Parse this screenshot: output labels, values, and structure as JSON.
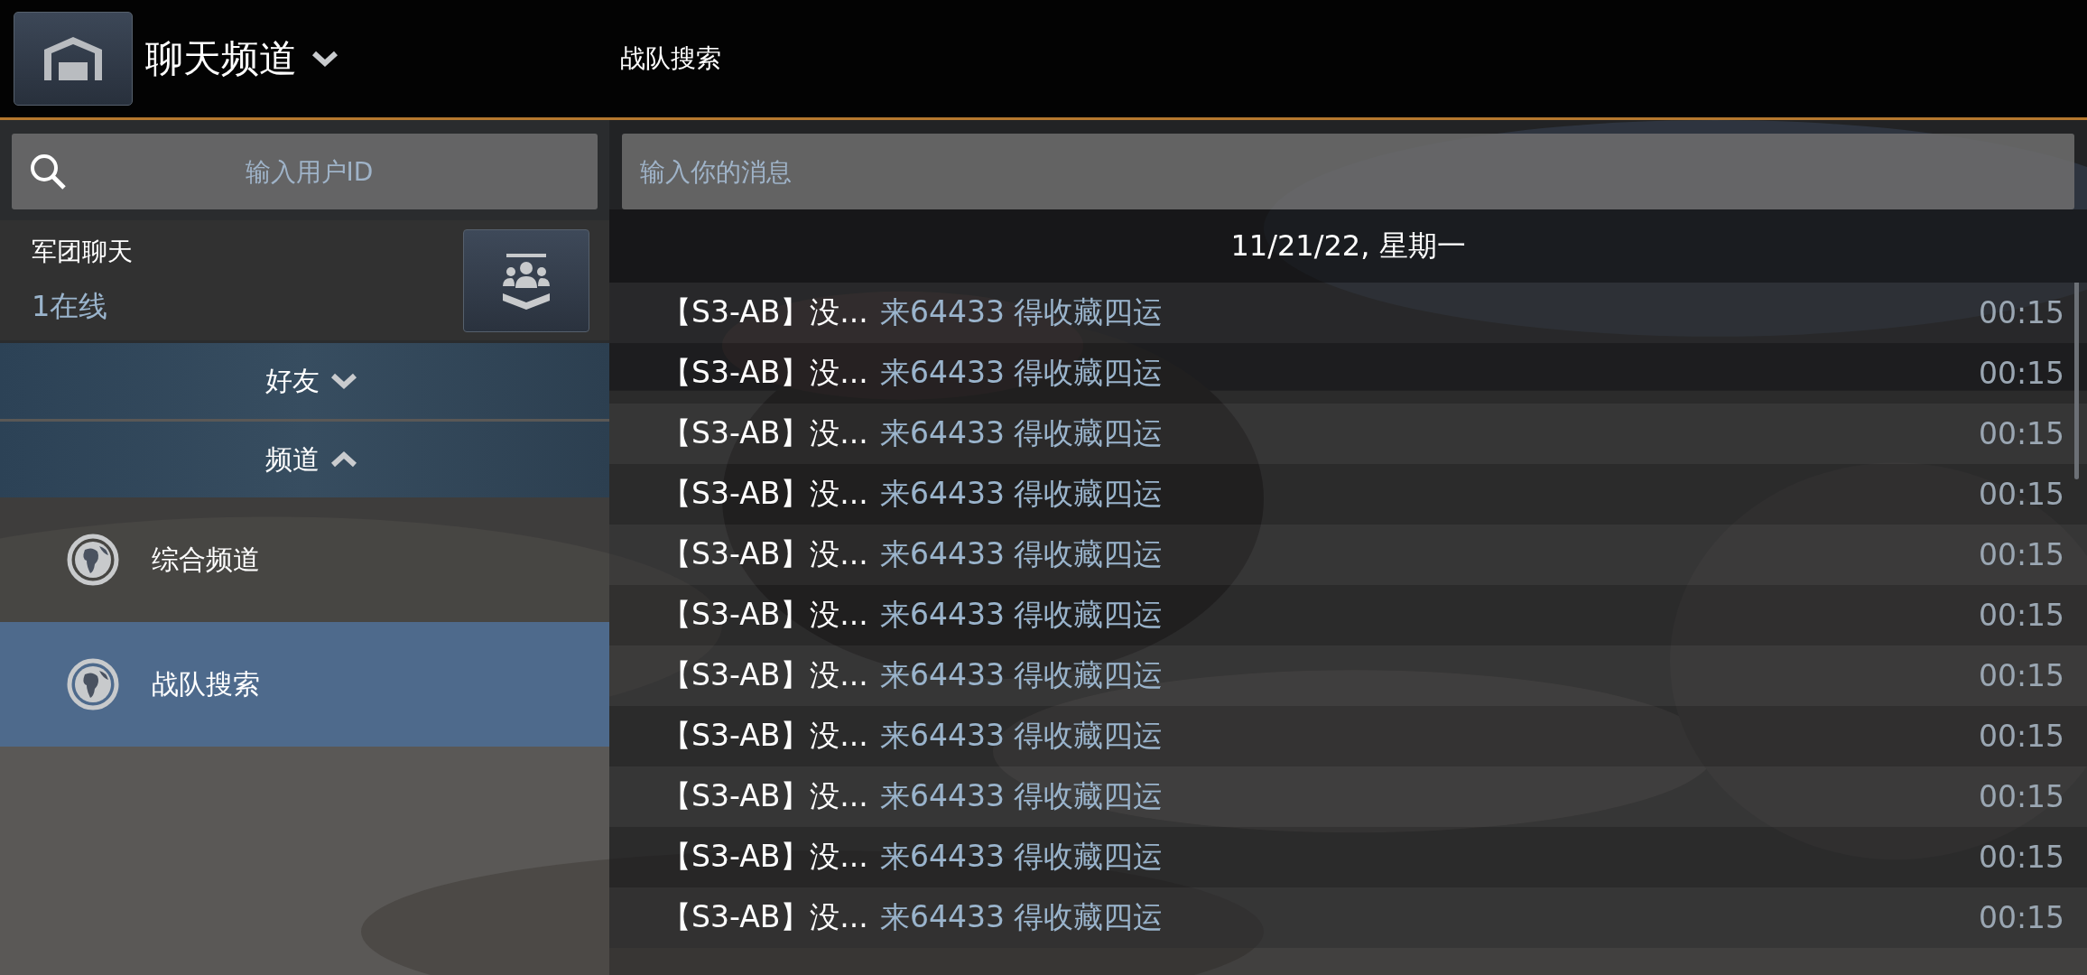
{
  "header": {
    "title": "聊天频道",
    "channel": "战队搜索"
  },
  "search": {
    "placeholder": "输入用户ID"
  },
  "legion": {
    "name": "军团聊天",
    "online": "1在线"
  },
  "sections": [
    {
      "label": "好友",
      "expanded": false
    },
    {
      "label": "频道",
      "expanded": true
    }
  ],
  "channels": [
    {
      "name": "综合频道",
      "selected": false
    },
    {
      "name": "战队搜索",
      "selected": true
    }
  ],
  "message_input": {
    "placeholder": "输入你的消息"
  },
  "date": "11/21/22, 星期一",
  "messages": [
    {
      "sender": "【S3-AB】没...",
      "text": "来64433 得收藏四运",
      "time": "00:15"
    },
    {
      "sender": "【S3-AB】没...",
      "text": "来64433 得收藏四运",
      "time": "00:15"
    },
    {
      "sender": "【S3-AB】没...",
      "text": "来64433 得收藏四运",
      "time": "00:15"
    },
    {
      "sender": "【S3-AB】没...",
      "text": "来64433 得收藏四运",
      "time": "00:15"
    },
    {
      "sender": "【S3-AB】没...",
      "text": "来64433 得收藏四运",
      "time": "00:15"
    },
    {
      "sender": "【S3-AB】没...",
      "text": "来64433 得收藏四运",
      "time": "00:15"
    },
    {
      "sender": "【S3-AB】没...",
      "text": "来64433 得收藏四运",
      "time": "00:15"
    },
    {
      "sender": "【S3-AB】没...",
      "text": "来64433 得收藏四运",
      "time": "00:15"
    },
    {
      "sender": "【S3-AB】没...",
      "text": "来64433 得收藏四运",
      "time": "00:15"
    },
    {
      "sender": "【S3-AB】没...",
      "text": "来64433 得收藏四运",
      "time": "00:15"
    },
    {
      "sender": "【S3-AB】没...",
      "text": "来64433 得收藏四运",
      "time": "00:15"
    }
  ]
}
